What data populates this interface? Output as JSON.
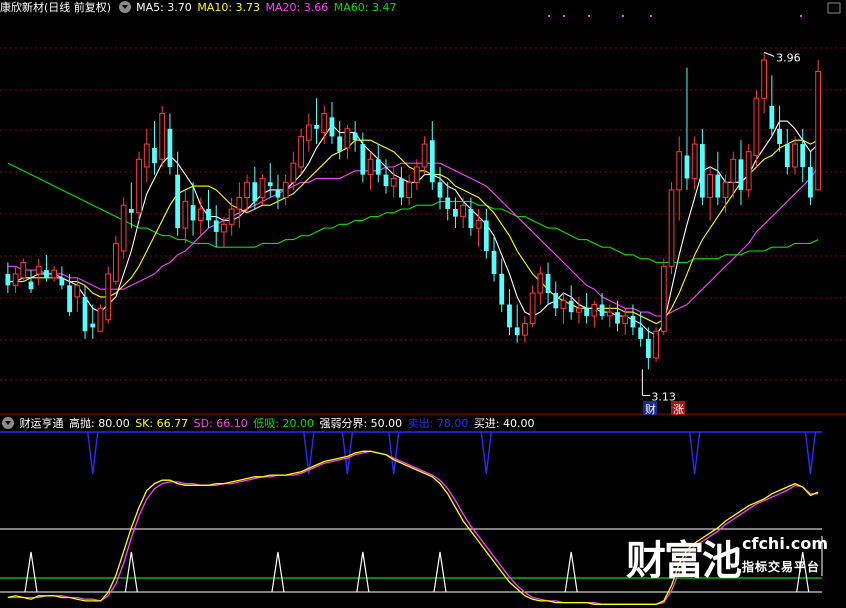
{
  "main_legend": {
    "stock_title": "康欣新材(日线 前复权)",
    "ma5": "MA5: 3.70",
    "ma10": "MA10: 3.73",
    "ma20": "MA20: 3.66",
    "ma60": "MA60: 3.47"
  },
  "indicator_legend": {
    "name": "财运亨通",
    "high_sell": "高抛: 80.00",
    "sk": "SK: 66.77",
    "sd": "SD: 66.10",
    "low_buy": "低吸: 20.00",
    "divider": "强弱分界: 50.00",
    "sell_out": "卖出: 78.00",
    "buy_in": "买进: 40.00"
  },
  "annotations": {
    "max_label": "3.96",
    "min_label": "3.13",
    "badge_cai": "财",
    "badge_zhang": "涨"
  },
  "watermark": {
    "brand": "财富池",
    "site": "cfchi.com",
    "slogan": "指标交易平台"
  },
  "colors": {
    "up": "#ff3b3b",
    "down": "#54ffff",
    "ma5": "#ffffff",
    "ma10": "#ffff00",
    "ma20": "#ff40ff",
    "ma60": "#00e000",
    "grid": "#8b0000",
    "signal_blue": "#2b2bff"
  },
  "chart_data": [
    {
      "type": "candlestick",
      "title": "康欣新材(日线 前复权)",
      "ylim": [
        3.05,
        4.05
      ],
      "candles": [
        [
          3.38,
          3.41,
          3.33,
          3.35
        ],
        [
          3.35,
          3.4,
          3.33,
          3.38
        ],
        [
          3.37,
          3.42,
          3.36,
          3.41
        ],
        [
          3.36,
          3.39,
          3.33,
          3.34
        ],
        [
          3.38,
          3.42,
          3.35,
          3.4
        ],
        [
          3.39,
          3.43,
          3.36,
          3.37
        ],
        [
          3.37,
          3.4,
          3.36,
          3.39
        ],
        [
          3.37,
          3.4,
          3.34,
          3.35
        ],
        [
          3.35,
          3.38,
          3.27,
          3.28
        ],
        [
          3.32,
          3.37,
          3.28,
          3.35
        ],
        [
          3.32,
          3.35,
          3.21,
          3.23
        ],
        [
          3.25,
          3.3,
          3.21,
          3.24
        ],
        [
          3.23,
          3.3,
          3.23,
          3.29
        ],
        [
          3.26,
          3.4,
          3.25,
          3.38
        ],
        [
          3.36,
          3.48,
          3.35,
          3.46
        ],
        [
          3.44,
          3.58,
          3.42,
          3.56
        ],
        [
          3.55,
          3.62,
          3.5,
          3.54
        ],
        [
          3.54,
          3.7,
          3.52,
          3.68
        ],
        [
          3.66,
          3.76,
          3.62,
          3.72
        ],
        [
          3.71,
          3.78,
          3.64,
          3.67
        ],
        [
          3.68,
          3.82,
          3.66,
          3.8
        ],
        [
          3.76,
          3.8,
          3.64,
          3.66
        ],
        [
          3.64,
          3.7,
          3.48,
          3.5
        ],
        [
          3.5,
          3.6,
          3.46,
          3.57
        ],
        [
          3.56,
          3.62,
          3.48,
          3.52
        ],
        [
          3.52,
          3.58,
          3.48,
          3.55
        ],
        [
          3.55,
          3.6,
          3.5,
          3.52
        ],
        [
          3.52,
          3.56,
          3.45,
          3.49
        ],
        [
          3.49,
          3.53,
          3.45,
          3.51
        ],
        [
          3.51,
          3.58,
          3.48,
          3.55
        ],
        [
          3.55,
          3.62,
          3.5,
          3.58
        ],
        [
          3.58,
          3.64,
          3.54,
          3.62
        ],
        [
          3.62,
          3.66,
          3.55,
          3.57
        ],
        [
          3.58,
          3.64,
          3.56,
          3.63
        ],
        [
          3.62,
          3.67,
          3.58,
          3.61
        ],
        [
          3.6,
          3.64,
          3.55,
          3.58
        ],
        [
          3.58,
          3.64,
          3.56,
          3.62
        ],
        [
          3.62,
          3.7,
          3.6,
          3.67
        ],
        [
          3.66,
          3.76,
          3.64,
          3.74
        ],
        [
          3.73,
          3.8,
          3.7,
          3.77
        ],
        [
          3.77,
          3.84,
          3.72,
          3.76
        ],
        [
          3.75,
          3.82,
          3.72,
          3.8
        ],
        [
          3.79,
          3.83,
          3.72,
          3.74
        ],
        [
          3.74,
          3.78,
          3.68,
          3.7
        ],
        [
          3.71,
          3.77,
          3.68,
          3.76
        ],
        [
          3.75,
          3.78,
          3.7,
          3.73
        ],
        [
          3.72,
          3.75,
          3.62,
          3.64
        ],
        [
          3.64,
          3.7,
          3.6,
          3.68
        ],
        [
          3.68,
          3.72,
          3.62,
          3.64
        ],
        [
          3.64,
          3.68,
          3.59,
          3.61
        ],
        [
          3.61,
          3.66,
          3.58,
          3.63
        ],
        [
          3.63,
          3.66,
          3.56,
          3.58
        ],
        [
          3.58,
          3.64,
          3.56,
          3.62
        ],
        [
          3.62,
          3.68,
          3.6,
          3.66
        ],
        [
          3.66,
          3.74,
          3.64,
          3.72
        ],
        [
          3.73,
          3.78,
          3.6,
          3.62
        ],
        [
          3.62,
          3.66,
          3.55,
          3.58
        ],
        [
          3.58,
          3.62,
          3.52,
          3.55
        ],
        [
          3.55,
          3.58,
          3.5,
          3.53
        ],
        [
          3.53,
          3.58,
          3.5,
          3.56
        ],
        [
          3.55,
          3.58,
          3.48,
          3.5
        ],
        [
          3.5,
          3.55,
          3.45,
          3.52
        ],
        [
          3.52,
          3.55,
          3.42,
          3.44
        ],
        [
          3.44,
          3.48,
          3.36,
          3.38
        ],
        [
          3.38,
          3.42,
          3.28,
          3.3
        ],
        [
          3.3,
          3.34,
          3.22,
          3.24
        ],
        [
          3.24,
          3.3,
          3.2,
          3.22
        ],
        [
          3.22,
          3.27,
          3.2,
          3.25
        ],
        [
          3.25,
          3.35,
          3.24,
          3.33
        ],
        [
          3.33,
          3.4,
          3.3,
          3.38
        ],
        [
          3.38,
          3.41,
          3.3,
          3.33
        ],
        [
          3.33,
          3.36,
          3.27,
          3.29
        ],
        [
          3.29,
          3.33,
          3.25,
          3.31
        ],
        [
          3.31,
          3.35,
          3.26,
          3.28
        ],
        [
          3.28,
          3.32,
          3.25,
          3.29
        ],
        [
          3.29,
          3.33,
          3.25,
          3.27
        ],
        [
          3.27,
          3.31,
          3.24,
          3.3
        ],
        [
          3.3,
          3.33,
          3.26,
          3.27
        ],
        [
          3.27,
          3.3,
          3.24,
          3.28
        ],
        [
          3.28,
          3.31,
          3.23,
          3.25
        ],
        [
          3.25,
          3.29,
          3.22,
          3.27
        ],
        [
          3.27,
          3.3,
          3.22,
          3.24
        ],
        [
          3.24,
          3.28,
          3.19,
          3.21
        ],
        [
          3.21,
          3.24,
          3.13,
          3.16
        ],
        [
          3.16,
          3.24,
          3.15,
          3.23
        ],
        [
          3.23,
          3.42,
          3.22,
          3.4
        ],
        [
          3.4,
          3.62,
          3.38,
          3.6
        ],
        [
          3.6,
          3.74,
          3.52,
          3.7
        ],
        [
          3.69,
          3.92,
          3.6,
          3.63
        ],
        [
          3.63,
          3.74,
          3.6,
          3.72
        ],
        [
          3.72,
          3.76,
          3.56,
          3.58
        ],
        [
          3.58,
          3.66,
          3.52,
          3.64
        ],
        [
          3.64,
          3.7,
          3.56,
          3.58
        ],
        [
          3.58,
          3.64,
          3.54,
          3.62
        ],
        [
          3.62,
          3.7,
          3.58,
          3.68
        ],
        [
          3.68,
          3.73,
          3.56,
          3.6
        ],
        [
          3.6,
          3.72,
          3.58,
          3.7
        ],
        [
          3.69,
          3.86,
          3.66,
          3.84
        ],
        [
          3.84,
          3.96,
          3.8,
          3.94
        ],
        [
          3.82,
          3.9,
          3.74,
          3.76
        ],
        [
          3.76,
          3.82,
          3.7,
          3.72
        ],
        [
          3.72,
          3.76,
          3.64,
          3.66
        ],
        [
          3.66,
          3.74,
          3.64,
          3.72
        ],
        [
          3.72,
          3.76,
          3.62,
          3.66
        ],
        [
          3.66,
          3.7,
          3.56,
          3.58
        ],
        [
          3.6,
          3.94,
          3.6,
          3.91
        ]
      ],
      "ma5": [
        3.36,
        3.36,
        3.37,
        3.37,
        3.38,
        3.38,
        3.38,
        3.37,
        3.36,
        3.35,
        3.32,
        3.29,
        3.28,
        3.3,
        3.32,
        3.38,
        3.44,
        3.52,
        3.59,
        3.63,
        3.67,
        3.69,
        3.67,
        3.64,
        3.61,
        3.56,
        3.53,
        3.53,
        3.52,
        3.52,
        3.53,
        3.55,
        3.57,
        3.59,
        3.6,
        3.6,
        3.6,
        3.62,
        3.64,
        3.67,
        3.71,
        3.74,
        3.77,
        3.75,
        3.75,
        3.75,
        3.72,
        3.7,
        3.68,
        3.66,
        3.64,
        3.63,
        3.62,
        3.62,
        3.64,
        3.64,
        3.63,
        3.61,
        3.6,
        3.57,
        3.55,
        3.53,
        3.51,
        3.48,
        3.43,
        3.38,
        3.32,
        3.28,
        3.27,
        3.28,
        3.3,
        3.31,
        3.33,
        3.32,
        3.3,
        3.29,
        3.29,
        3.28,
        3.28,
        3.27,
        3.27,
        3.26,
        3.25,
        3.23,
        3.22,
        3.25,
        3.34,
        3.43,
        3.51,
        3.58,
        3.65,
        3.66,
        3.65,
        3.62,
        3.62,
        3.62,
        3.64,
        3.68,
        3.71,
        3.74,
        3.78,
        3.78,
        3.76,
        3.73,
        3.7,
        3.72
      ],
      "ma10": [
        3.36,
        3.36,
        3.36,
        3.37,
        3.37,
        3.37,
        3.37,
        3.37,
        3.36,
        3.36,
        3.35,
        3.33,
        3.32,
        3.32,
        3.33,
        3.35,
        3.37,
        3.4,
        3.44,
        3.48,
        3.52,
        3.56,
        3.59,
        3.6,
        3.61,
        3.61,
        3.61,
        3.6,
        3.58,
        3.56,
        3.55,
        3.54,
        3.55,
        3.56,
        3.56,
        3.57,
        3.58,
        3.59,
        3.61,
        3.63,
        3.65,
        3.67,
        3.69,
        3.7,
        3.71,
        3.73,
        3.73,
        3.73,
        3.72,
        3.71,
        3.7,
        3.68,
        3.66,
        3.65,
        3.65,
        3.64,
        3.64,
        3.63,
        3.61,
        3.6,
        3.59,
        3.58,
        3.56,
        3.54,
        3.51,
        3.48,
        3.44,
        3.41,
        3.38,
        3.36,
        3.34,
        3.32,
        3.31,
        3.3,
        3.29,
        3.29,
        3.29,
        3.29,
        3.29,
        3.29,
        3.28,
        3.28,
        3.27,
        3.26,
        3.25,
        3.26,
        3.29,
        3.33,
        3.38,
        3.43,
        3.47,
        3.5,
        3.53,
        3.56,
        3.59,
        3.62,
        3.64,
        3.66,
        3.68,
        3.69,
        3.71,
        3.72,
        3.73,
        3.73,
        3.72,
        3.73
      ],
      "ma20": [
        3.4,
        3.4,
        3.39,
        3.39,
        3.39,
        3.38,
        3.38,
        3.38,
        3.37,
        3.37,
        3.36,
        3.35,
        3.34,
        3.34,
        3.34,
        3.34,
        3.35,
        3.36,
        3.37,
        3.38,
        3.4,
        3.41,
        3.43,
        3.44,
        3.46,
        3.48,
        3.5,
        3.51,
        3.52,
        3.53,
        3.54,
        3.55,
        3.56,
        3.57,
        3.58,
        3.59,
        3.6,
        3.61,
        3.62,
        3.62,
        3.63,
        3.63,
        3.63,
        3.63,
        3.64,
        3.65,
        3.65,
        3.65,
        3.65,
        3.66,
        3.66,
        3.67,
        3.67,
        3.67,
        3.67,
        3.67,
        3.67,
        3.66,
        3.65,
        3.64,
        3.63,
        3.62,
        3.61,
        3.59,
        3.57,
        3.55,
        3.53,
        3.51,
        3.49,
        3.47,
        3.45,
        3.43,
        3.41,
        3.39,
        3.37,
        3.35,
        3.34,
        3.32,
        3.31,
        3.3,
        3.29,
        3.29,
        3.28,
        3.28,
        3.27,
        3.27,
        3.28,
        3.29,
        3.3,
        3.32,
        3.34,
        3.36,
        3.38,
        3.4,
        3.42,
        3.44,
        3.46,
        3.49,
        3.51,
        3.53,
        3.55,
        3.57,
        3.59,
        3.61,
        3.63,
        3.66
      ],
      "ma60": [
        3.67,
        3.66,
        3.65,
        3.64,
        3.63,
        3.62,
        3.61,
        3.6,
        3.59,
        3.58,
        3.57,
        3.56,
        3.55,
        3.54,
        3.53,
        3.52,
        3.51,
        3.5,
        3.5,
        3.49,
        3.48,
        3.48,
        3.47,
        3.47,
        3.46,
        3.46,
        3.46,
        3.45,
        3.45,
        3.45,
        3.45,
        3.45,
        3.45,
        3.46,
        3.46,
        3.46,
        3.47,
        3.47,
        3.48,
        3.48,
        3.49,
        3.5,
        3.5,
        3.51,
        3.51,
        3.52,
        3.52,
        3.53,
        3.53,
        3.54,
        3.54,
        3.55,
        3.55,
        3.56,
        3.56,
        3.56,
        3.57,
        3.57,
        3.57,
        3.57,
        3.57,
        3.56,
        3.56,
        3.55,
        3.55,
        3.54,
        3.53,
        3.53,
        3.52,
        3.51,
        3.5,
        3.5,
        3.49,
        3.48,
        3.47,
        3.47,
        3.46,
        3.45,
        3.45,
        3.44,
        3.43,
        3.43,
        3.42,
        3.42,
        3.41,
        3.41,
        3.41,
        3.41,
        3.41,
        3.42,
        3.42,
        3.42,
        3.42,
        3.43,
        3.43,
        3.43,
        3.44,
        3.44,
        3.44,
        3.45,
        3.45,
        3.45,
        3.46,
        3.46,
        3.46,
        3.47
      ],
      "signals": [
        {
          "label": "财",
          "index": 85
        },
        {
          "label": "涨",
          "index": 86
        }
      ]
    },
    {
      "type": "line",
      "title": "财运亨通",
      "ylim": [
        0,
        100
      ],
      "reference_lines": {
        "high_sell": 80,
        "divider": 50,
        "low_buy": 20,
        "sell_out": 78,
        "buy_in": 40
      },
      "sk": [
        5,
        6,
        5,
        4,
        6,
        6,
        6,
        5,
        5,
        4,
        3,
        3,
        3,
        8,
        18,
        32,
        46,
        58,
        68,
        72,
        74,
        74,
        72,
        71,
        71,
        71,
        71,
        72,
        72,
        73,
        74,
        75,
        76,
        76,
        77,
        77,
        77,
        78,
        79,
        81,
        83,
        85,
        86,
        87,
        88,
        90,
        91,
        91,
        90,
        89,
        86,
        84,
        82,
        80,
        78,
        76,
        72,
        66,
        58,
        50,
        44,
        38,
        32,
        26,
        20,
        14,
        10,
        6,
        4,
        3,
        3,
        2,
        2,
        2,
        2,
        2,
        1,
        1,
        1,
        1,
        1,
        1,
        1,
        1,
        1,
        3,
        12,
        25,
        33,
        37,
        40,
        43,
        46,
        50,
        53,
        56,
        59,
        61,
        63,
        66,
        68,
        70,
        72,
        70,
        65,
        67
      ],
      "sd": [
        5,
        5,
        5,
        5,
        5,
        6,
        6,
        6,
        5,
        5,
        4,
        4,
        3,
        6,
        13,
        25,
        40,
        53,
        63,
        69,
        72,
        73,
        73,
        72,
        72,
        71,
        71,
        71,
        72,
        72,
        73,
        74,
        75,
        76,
        76,
        77,
        77,
        77,
        78,
        80,
        82,
        84,
        85,
        86,
        87,
        89,
        90,
        91,
        90,
        89,
        87,
        85,
        83,
        81,
        79,
        77,
        74,
        69,
        62,
        54,
        47,
        41,
        35,
        29,
        23,
        17,
        12,
        8,
        5,
        4,
        3,
        3,
        2,
        2,
        2,
        2,
        2,
        1,
        1,
        1,
        1,
        1,
        1,
        1,
        1,
        2,
        9,
        20,
        30,
        35,
        38,
        41,
        44,
        48,
        51,
        54,
        57,
        60,
        62,
        64,
        66,
        68,
        71,
        70,
        66,
        66
      ],
      "upper_signal_dips": [
        11,
        39,
        44,
        50,
        62,
        89,
        104
      ],
      "lower_signal_spikes": [
        3,
        16,
        35,
        46,
        56,
        73,
        103
      ],
      "xlim": [
        0,
        106
      ]
    }
  ]
}
